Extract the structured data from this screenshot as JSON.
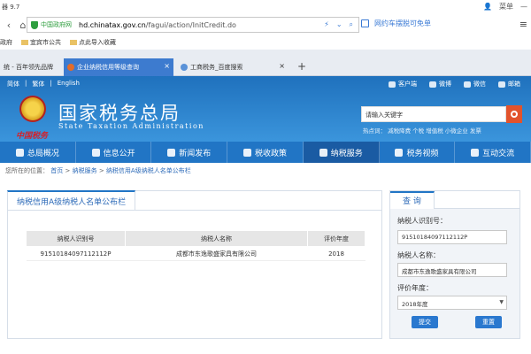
{
  "browser": {
    "title": "器 9.7",
    "win_menu": "菜单",
    "url_site": "中国政府网",
    "url_domain": "hd.chinatax.gov.cn",
    "url_path": "/fagui/action/InitCredit.do",
    "promo": "网约车摆脱可免单",
    "bookmarks": [
      "政府",
      "宜宾市公共",
      "点此导入收藏"
    ],
    "tabs": [
      "统 - 百年领先品牌",
      "企业纳税信用等级查询",
      "工商税务_百度搜索"
    ]
  },
  "header": {
    "links": [
      "简体",
      "繁体",
      "English"
    ],
    "social": [
      "客户端",
      "微博",
      "微信",
      "邮箱"
    ],
    "site_name": "国家税务总局",
    "site_en": "State Taxation Administration",
    "calligraphy": "中国税务",
    "search_placeholder": "请输入关键字",
    "hot_words": "热点词： 减税降费 个税 增值税 小微企业 发票"
  },
  "nav": [
    "总局概况",
    "信息公开",
    "新闻发布",
    "税收政策",
    "纳税服务",
    "税务视频",
    "互动交流"
  ],
  "breadcrumb": {
    "prefix": "您所在的位置：",
    "home": "首页",
    "sep": ">",
    "level1": "纳税服务",
    "level2": "纳税信用A级纳税人名单公布栏"
  },
  "panel": {
    "title": "纳税信用A级纳税人名单公布栏",
    "columns": [
      "纳税人识别号",
      "纳税人名称",
      "评价年度"
    ],
    "rows": [
      [
        "91510184097112112P",
        "成都市东逸歌盛家具有限公司",
        "2018"
      ]
    ]
  },
  "query": {
    "tab": "查  询",
    "id_label": "纳税人识别号：",
    "id_value": "91510184097112112P",
    "name_label": "纳税人名称：",
    "name_value": "成都市东逸歌盛家具有限公司",
    "year_label": "评价年度：",
    "year_value": "2018年度",
    "submit": "提交",
    "reset": "重置"
  },
  "colors": {
    "primary": "#2175c5",
    "search_btn": "#e2532c"
  }
}
